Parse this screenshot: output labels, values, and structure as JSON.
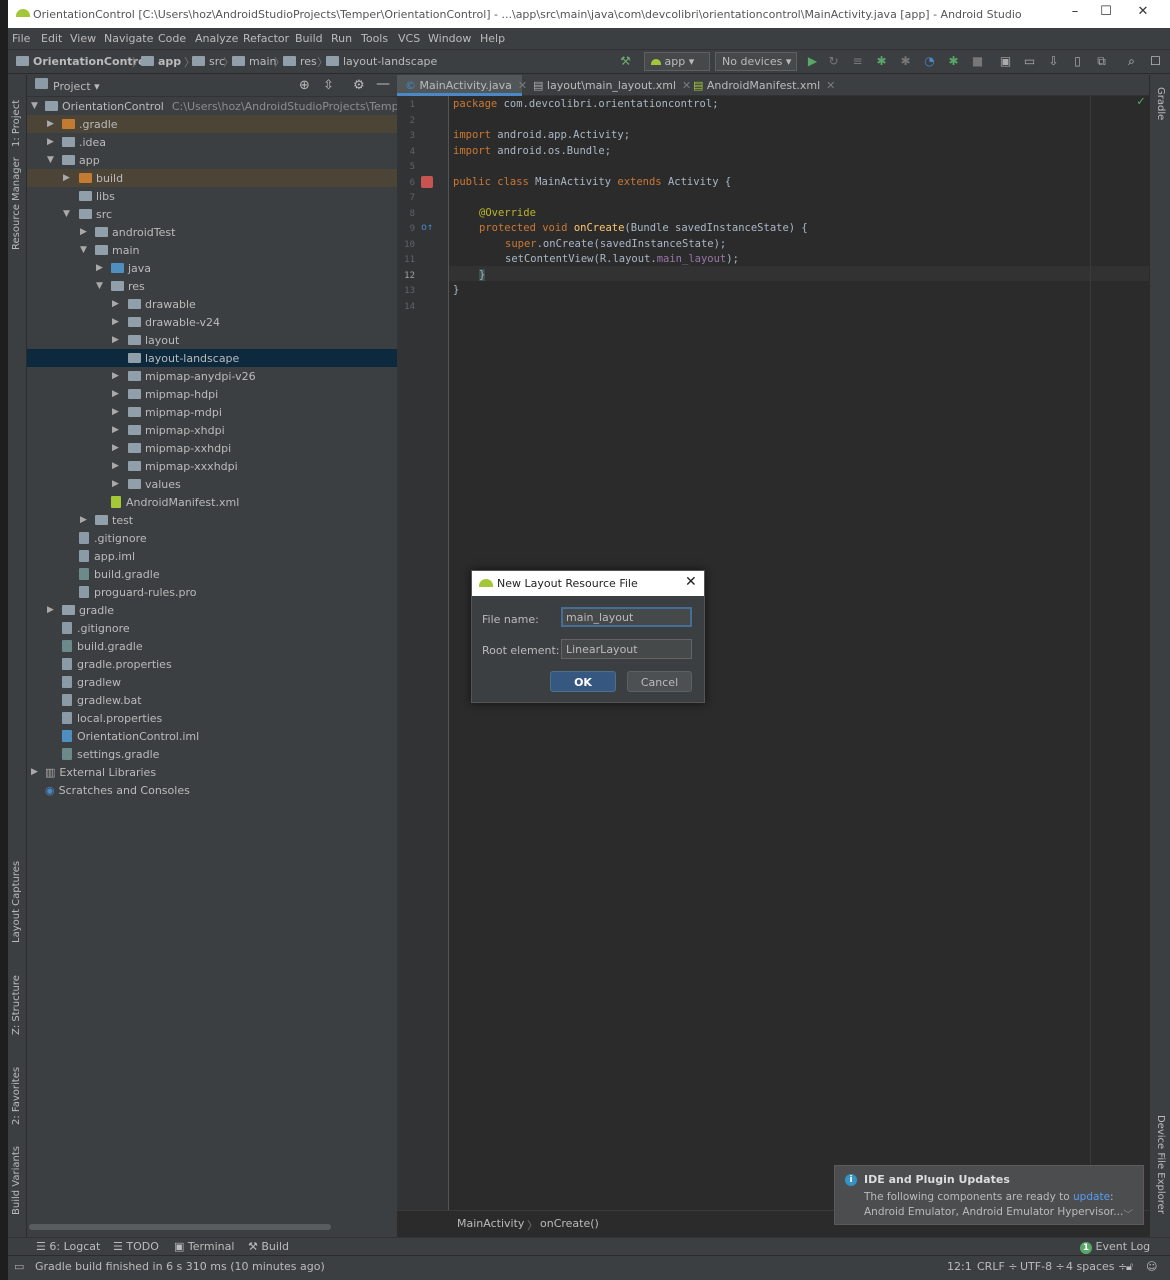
{
  "window": {
    "title": "OrientationControl [C:\\Users\\hoz\\AndroidStudioProjects\\Temper\\OrientationControl] - ...\\app\\src\\main\\java\\com\\devcolibri\\orientationcontrol\\MainActivity.java [app] - Android Studio",
    "controls": [
      "–",
      "☐",
      "✕"
    ]
  },
  "menu": [
    "File",
    "Edit",
    "View",
    "Navigate",
    "Code",
    "Analyze",
    "Refactor",
    "Build",
    "Run",
    "Tools",
    "VCS",
    "Window",
    "Help"
  ],
  "breadcrumbs": [
    "OrientationControl",
    "app",
    "src",
    "main",
    "res",
    "layout-landscape"
  ],
  "toolbar": {
    "run_config": "app",
    "device": "No devices"
  },
  "left_strip": {
    "project": "1: Project",
    "resource_manager": "Resource Manager",
    "layout_captures": "Layout Captures",
    "structure": "Z: Structure",
    "favorites": "2: Favorites",
    "build_variants": "Build Variants"
  },
  "right_strip": {
    "gradle": "Gradle",
    "device_file_explorer": "Device File Explorer"
  },
  "project_panel": {
    "title": "Project"
  },
  "tree": [
    {
      "label": "OrientationControl",
      "path": "C:\\Users\\hoz\\AndroidStudioProjects\\Temper\\Ori"
    },
    {
      "label": ".gradle"
    },
    {
      "label": ".idea"
    },
    {
      "label": "app"
    },
    {
      "label": "build"
    },
    {
      "label": "libs"
    },
    {
      "label": "src"
    },
    {
      "label": "androidTest"
    },
    {
      "label": "main"
    },
    {
      "label": "java"
    },
    {
      "label": "res"
    },
    {
      "label": "drawable"
    },
    {
      "label": "drawable-v24"
    },
    {
      "label": "layout"
    },
    {
      "label": "layout-landscape"
    },
    {
      "label": "mipmap-anydpi-v26"
    },
    {
      "label": "mipmap-hdpi"
    },
    {
      "label": "mipmap-mdpi"
    },
    {
      "label": "mipmap-xhdpi"
    },
    {
      "label": "mipmap-xxhdpi"
    },
    {
      "label": "mipmap-xxxhdpi"
    },
    {
      "label": "values"
    },
    {
      "label": "AndroidManifest.xml"
    },
    {
      "label": "test"
    },
    {
      "label": ".gitignore"
    },
    {
      "label": "app.iml"
    },
    {
      "label": "build.gradle"
    },
    {
      "label": "proguard-rules.pro"
    },
    {
      "label": "gradle"
    },
    {
      "label": ".gitignore"
    },
    {
      "label": "build.gradle"
    },
    {
      "label": "gradle.properties"
    },
    {
      "label": "gradlew"
    },
    {
      "label": "gradlew.bat"
    },
    {
      "label": "local.properties"
    },
    {
      "label": "OrientationControl.iml"
    },
    {
      "label": "settings.gradle"
    },
    {
      "label": "External Libraries"
    },
    {
      "label": "Scratches and Consoles"
    }
  ],
  "editor_tabs": [
    "MainActivity.java",
    "layout\\main_layout.xml",
    "AndroidManifest.xml"
  ],
  "code": {
    "l1a": "package",
    "l1b": " com.devcolibri.orientationcontrol;",
    "l3a": "import",
    "l3b": " android.app.Activity;",
    "l4a": "import",
    "l4b": " android.os.Bundle;",
    "l6a": "public class",
    "l6b": " MainActivity ",
    "l6c": "extends",
    "l6d": " Activity {",
    "l8": "@Override",
    "l9a": "protected void",
    "l9b": " onCreate",
    "l9c": "(Bundle savedInstanceState) {",
    "l10a": "super",
    "l10b": ".onCreate(savedInstanceState);",
    "l11a": "setContentView(R.layout.",
    "l11b": "main_layout",
    "l11c": ");",
    "l12": "}",
    "l13": "}"
  },
  "editor_breadcrumb": [
    "MainActivity",
    "onCreate()"
  ],
  "dialog": {
    "title": "New Layout Resource File",
    "file_name_label": "File name:",
    "file_name_value": "main_layout",
    "root_element_label": "Root element:",
    "root_element_value": "LinearLayout",
    "ok": "OK",
    "cancel": "Cancel"
  },
  "notification": {
    "title": "IDE and Plugin Updates",
    "text": "The following components are ready to",
    "link": "update",
    "colon": ":",
    "components": "Android Emulator, Android Emulator Hypervisor..."
  },
  "bottom_tabs": [
    "6: Logcat",
    "TODO",
    "Terminal",
    "Build"
  ],
  "event_log": {
    "count": "1",
    "label": "Event Log"
  },
  "status": {
    "message": "Gradle build finished in 6 s 310 ms (10 minutes ago)",
    "position": "12:1",
    "line_sep": "CRLF ÷",
    "encoding": "UTF-8 ÷",
    "indent": "4 spaces ÷"
  }
}
